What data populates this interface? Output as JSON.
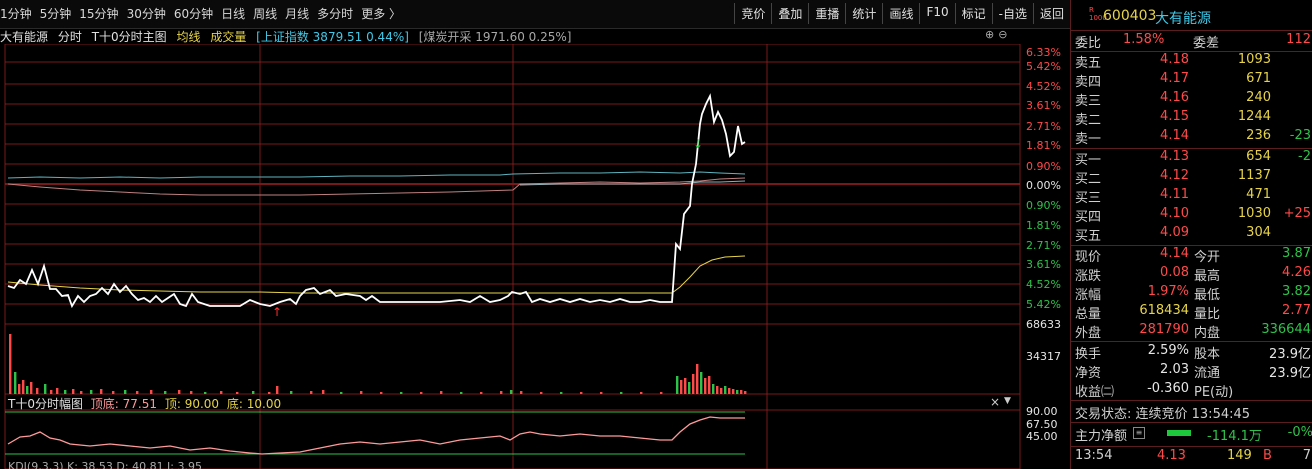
{
  "toolbar": {
    "periods": [
      "1分钟",
      "5分钟",
      "15分钟",
      "30分钟",
      "60分钟",
      "日线",
      "周线",
      "月线",
      "多分时",
      "更多 〉"
    ],
    "tools": [
      "竞价",
      "叠加",
      "重播",
      "统计",
      "画线",
      "F10",
      "标记",
      "-自选",
      "返回"
    ]
  },
  "chart_header": {
    "stock_name": "大有能源",
    "mode": "分时",
    "main_label": "T十0分时主图",
    "avg_label": "均线",
    "volume_label": "成交量",
    "index_info": "[上证指数 3879.51 0.44%]",
    "sector_info": "[煤炭开采 1971.60 0.25%]"
  },
  "price_axis": [
    "6.33%",
    "5.42%",
    "4.52%",
    "3.61%",
    "2.71%",
    "1.81%",
    "0.90%",
    "0.00%",
    "0.90%",
    "1.81%",
    "2.71%",
    "3.61%",
    "4.52%",
    "5.42%"
  ],
  "volume_axis": [
    "68633",
    "34317"
  ],
  "indicator": {
    "title": "T十0分时幅图",
    "bottom_label": "顶底: 77.51",
    "top_label": "顶: 90.00",
    "floor_label": "底: 10.00",
    "axis": [
      "90.00",
      "67.50",
      "45.00"
    ]
  },
  "kdj_partial": "KDJ(9,3,3)  K: 38.53  D: 40.81  J: 3.95",
  "panel": {
    "market_badge": "R\n1000",
    "code": "600403",
    "name": "大有能源",
    "webi_label": "委比",
    "webi_value": "1.58%",
    "weicha_label": "委差",
    "weicha_value": "112",
    "asks": [
      {
        "label": "卖五",
        "price": "4.18",
        "vol": "1093",
        "chg": ""
      },
      {
        "label": "卖四",
        "price": "4.17",
        "vol": "671",
        "chg": ""
      },
      {
        "label": "卖三",
        "price": "4.16",
        "vol": "240",
        "chg": ""
      },
      {
        "label": "卖二",
        "price": "4.15",
        "vol": "1244",
        "chg": ""
      },
      {
        "label": "卖一",
        "price": "4.14",
        "vol": "236",
        "chg": "-23"
      }
    ],
    "bids": [
      {
        "label": "买一",
        "price": "4.13",
        "vol": "654",
        "chg": "-2"
      },
      {
        "label": "买二",
        "price": "4.12",
        "vol": "1137",
        "chg": ""
      },
      {
        "label": "买三",
        "price": "4.11",
        "vol": "471",
        "chg": ""
      },
      {
        "label": "买四",
        "price": "4.10",
        "vol": "1030",
        "chg": "+25"
      },
      {
        "label": "买五",
        "price": "4.09",
        "vol": "304",
        "chg": ""
      }
    ],
    "quote": [
      {
        "l1": "现价",
        "v1": "4.14",
        "l2": "今开",
        "v2": "3.87",
        "c1": "#ff4a4a",
        "c2": "#2fc24a"
      },
      {
        "l1": "涨跌",
        "v1": "0.08",
        "l2": "最高",
        "v2": "4.26",
        "c1": "#ff4a4a",
        "c2": "#ff4a4a"
      },
      {
        "l1": "涨幅",
        "v1": "1.97%",
        "l2": "最低",
        "v2": "3.82",
        "c1": "#ff4a4a",
        "c2": "#2fc24a"
      },
      {
        "l1": "总量",
        "v1": "618434",
        "l2": "量比",
        "v2": "2.77",
        "c1": "#e6d34a",
        "c2": "#ff4a4a"
      },
      {
        "l1": "外盘",
        "v1": "281790",
        "l2": "内盘",
        "v2": "336644",
        "c1": "#ff4a4a",
        "c2": "#2fc24a"
      }
    ],
    "stats": [
      {
        "l1": "换手",
        "v1": "2.59%",
        "l2": "股本",
        "v2": "23.9亿"
      },
      {
        "l1": "净资",
        "v1": "2.03",
        "l2": "流通",
        "v2": "23.9亿"
      },
      {
        "l1": "收益㈡",
        "v1": "-0.360",
        "l2": "PE(动)",
        "v2": ""
      }
    ],
    "trade_status": "交易状态: 连续竞价 13:54:45",
    "main_flow_label": "主力净额",
    "main_flow_value": "-114.1万",
    "main_flow_pct": "-0%",
    "tick": {
      "time": "13:54",
      "price": "4.13",
      "vol": "149",
      "side": "B",
      "num": "7"
    }
  },
  "colors": {
    "up": "#ff4a4a",
    "down": "#2fc24a",
    "grid": "#7a1a1a",
    "price_line": "#ffffff",
    "avg_line": "#e6d34a"
  }
}
